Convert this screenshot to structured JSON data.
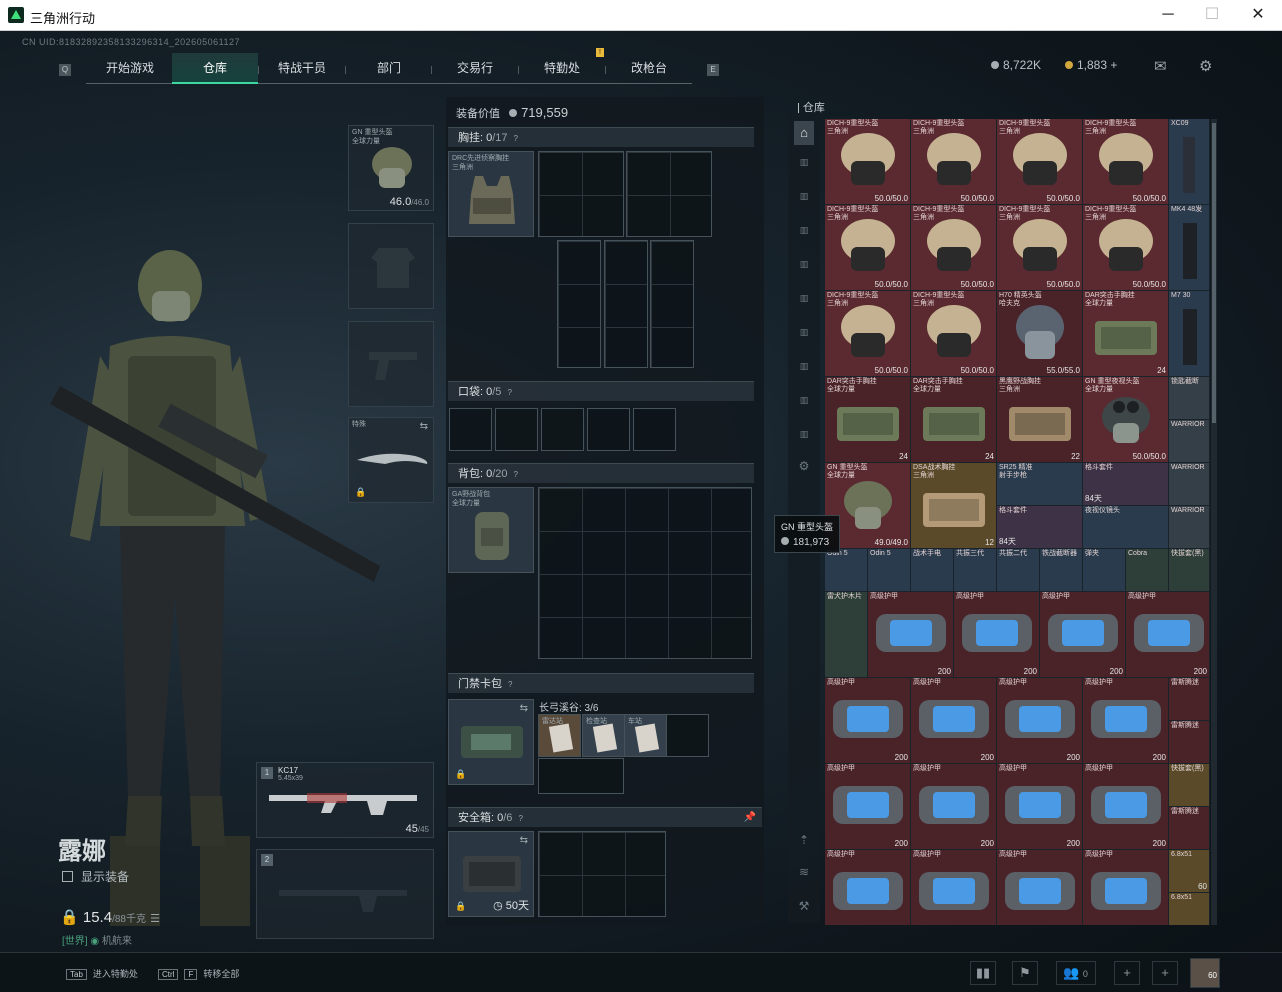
{
  "window": {
    "title": "三角洲行动"
  },
  "uid": "CN UID:818328923581332963​14_202605061127",
  "tabs": [
    {
      "label": "开始游戏"
    },
    {
      "label": "仓库",
      "active": true
    },
    {
      "label": "特战干员"
    },
    {
      "label": "部门"
    },
    {
      "label": "交易行"
    },
    {
      "label": "特勤处"
    },
    {
      "label": "改枪台"
    }
  ],
  "currency": {
    "silver": "8,722K",
    "gold": "1,883",
    "plus": "+"
  },
  "operator": {
    "name": "露娜",
    "show_equipment": "显示装备",
    "weight": "15.4",
    "weight_max": "/88千克",
    "world_tag": "[世界]",
    "world_text": "机航来"
  },
  "equipment": {
    "helmet": {
      "name": "GN 重型头盔",
      "sub": "全球力量",
      "durability": "46.0",
      "max": "/46.0"
    },
    "knife_label": "特殊",
    "weapon1": {
      "index": "1",
      "name": "KC17",
      "caliber": "5.45x39",
      "ammo": "45",
      "ammo_max": "/45"
    },
    "weapon2": {
      "index": "2"
    }
  },
  "loadout": {
    "value_label": "装备价值",
    "value": "719,559",
    "chest": {
      "label": "胸挂:",
      "count": "0",
      "max": "/17",
      "item_name": "DRC先进侦察胸挂",
      "item_sub": "三角洲"
    },
    "pocket": {
      "label": "口袋:",
      "count": "0",
      "max": "/5"
    },
    "backpack": {
      "label": "背包:",
      "count": "0",
      "max": "/20",
      "item_name": "GA野战背包",
      "item_sub": "全球力量"
    },
    "keycard": {
      "label": "门禁卡包",
      "map": "长弓溪谷: 3/6",
      "cards": [
        "雷达站",
        "检查站",
        "车站"
      ]
    },
    "safebox": {
      "label": "安全箱:",
      "count": "0",
      "max": "/6",
      "days": "50天"
    }
  },
  "stash": {
    "title": "仓库",
    "items": [
      {
        "name": "DICH-9重型头盔",
        "sub": "三角洲",
        "val": "50.0/50.0"
      },
      {
        "name": "DICH-9重型头盔",
        "sub": "三角洲",
        "val": "50.0/50.0"
      },
      {
        "name": "DICH-9重型头盔",
        "sub": "三角洲",
        "val": "50.0/50.0"
      },
      {
        "name": "DICH-9重型头盔",
        "sub": "三角洲",
        "val": "50.0/50.0"
      },
      {
        "name": "DICH-9重型头盔",
        "sub": "三角洲",
        "val": "50.0/50.0"
      },
      {
        "name": "DICH-9重型头盔",
        "sub": "三角洲",
        "val": "50.0/50.0"
      },
      {
        "name": "DICH-9重型头盔",
        "sub": "三角洲",
        "val": "50.0/50.0"
      },
      {
        "name": "DICH-9重型头盔",
        "sub": "三角洲",
        "val": "50.0/50.0"
      },
      {
        "name": "DICH-9重型头盔",
        "sub": "三角洲",
        "val": "50.0/50.0"
      },
      {
        "name": "DICH-9重型头盔",
        "sub": "三角洲",
        "val": "50.0/50.0"
      },
      {
        "name": "H70 精英头盔",
        "sub": "哈夫克",
        "val": "55.0/55.0"
      },
      {
        "name": "DAR突击手胸挂",
        "sub": "全球力量",
        "val": "24"
      },
      {
        "name": "DAR突击手胸挂",
        "sub": "全球力量",
        "val": "24"
      },
      {
        "name": "DAR突击手胸挂",
        "sub": "全球力量",
        "val": "24"
      },
      {
        "name": "黑鹰野战胸挂",
        "sub": "三角洲",
        "val": "22"
      },
      {
        "name": "GN 重型夜视头盔",
        "sub": "全球力量",
        "val": "50.0/50.0"
      },
      {
        "name": "GN 重型头盔",
        "sub": "全球力量",
        "val": "49.0/49.0"
      },
      {
        "name": "DSA战术胸挂",
        "sub": "三角洲",
        "val": "12"
      },
      {
        "name": "SR25 精准",
        "sub": "射手步枪",
        "val": ""
      },
      {
        "name": "格斗套件",
        "sub": "",
        "val": "84天"
      },
      {
        "name": "格斗套件",
        "sub": "",
        "val": "84天"
      },
      {
        "name": "夜视仪镜头",
        "sub": "",
        "val": ""
      },
      {
        "name": "高级护甲",
        "sub": "",
        "val": "200"
      },
      {
        "name": "XC09",
        "sub": "",
        "val": ""
      },
      {
        "name": "MK4 48发",
        "sub": "",
        "val": ""
      },
      {
        "name": "M7 30",
        "sub": "",
        "val": ""
      },
      {
        "name": "锁匙截断",
        "sub": "",
        "val": ""
      },
      {
        "name": "WARRIOR",
        "sub": "",
        "val": ""
      },
      {
        "name": "雷斯腾迷",
        "sub": "",
        "val": ""
      },
      {
        "name": "快拔套(黑)",
        "sub": "",
        "val": ""
      },
      {
        "name": "6.8x51",
        "sub": "",
        "val": "60"
      }
    ],
    "small_row": [
      "Odin 5",
      "Odin 5",
      "战术手电",
      "共振三代",
      "共振二代",
      "铁战截断器",
      "弹夹",
      "Cobra",
      "快拔套(黑)"
    ],
    "kit": "雷犬护木片"
  },
  "tooltip": {
    "name": "GN 重型头盔",
    "price": "181,973"
  },
  "bottom": {
    "hint1_key": "Tab",
    "hint1": "进入特勤处",
    "hint2_key": "Ctrl",
    "hint2_key2": "F",
    "hint2": "转移全部",
    "friends": "0",
    "avatar_level": "60"
  },
  "colors": {
    "accent": "#3cd6a0",
    "rare_red": "#5b2a30",
    "gold": "#e8b83a"
  }
}
